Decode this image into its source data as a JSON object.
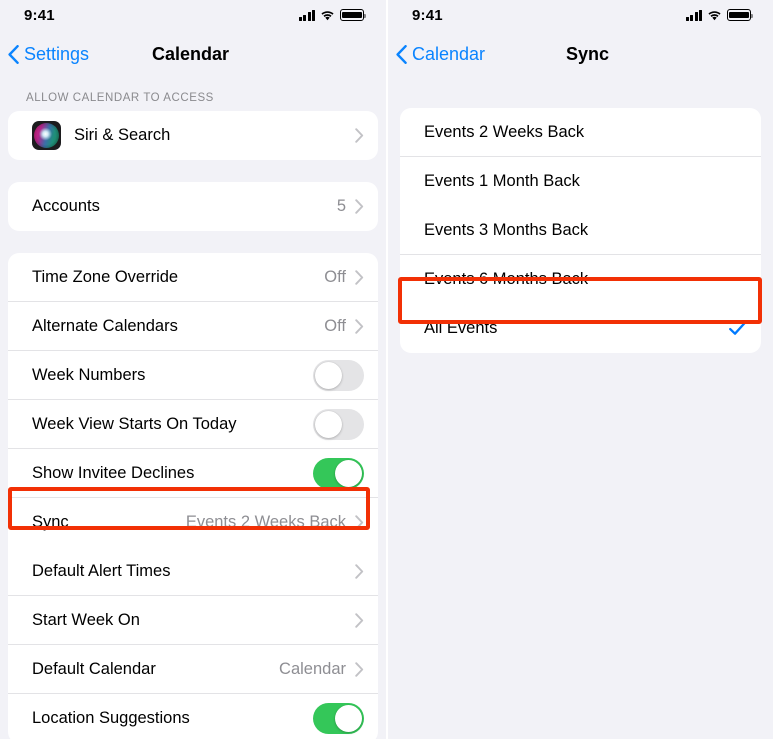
{
  "colors": {
    "accent_blue": "#0a84ff",
    "check_blue": "#007aff",
    "toggle_on_green": "#34c759",
    "highlight_red": "#f23005",
    "page_background": "#f2f2f7",
    "card_background": "#ffffff",
    "secondary_text": "#8e8e93"
  },
  "left_panel": {
    "status_bar": {
      "time": "9:41",
      "cellular_icon": "cellular-signal-icon",
      "wifi_icon": "wifi-icon",
      "battery_icon": "battery-full-icon"
    },
    "nav": {
      "back_label": "Settings",
      "back_icon": "chevron-left-icon",
      "title": "Calendar"
    },
    "sections": [
      {
        "header": "ALLOW CALENDAR TO ACCESS",
        "rows": [
          {
            "label": "Siri & Search",
            "value": "",
            "type": "disclosure",
            "icon": "siri-icon"
          }
        ]
      },
      {
        "header": "",
        "rows": [
          {
            "label": "Accounts",
            "value": "5",
            "type": "disclosure"
          }
        ]
      },
      {
        "header": "",
        "rows": [
          {
            "label": "Time Zone Override",
            "value": "Off",
            "type": "disclosure"
          },
          {
            "label": "Alternate Calendars",
            "value": "Off",
            "type": "disclosure"
          },
          {
            "label": "Week Numbers",
            "value": "",
            "type": "toggle",
            "on": false
          },
          {
            "label": "Week View Starts On Today",
            "value": "",
            "type": "toggle",
            "on": false
          },
          {
            "label": "Show Invitee Declines",
            "value": "",
            "type": "toggle",
            "on": true
          },
          {
            "label": "Sync",
            "value": "Events 2 Weeks Back",
            "type": "disclosure",
            "highlighted": true
          },
          {
            "label": "Default Alert Times",
            "value": "",
            "type": "disclosure"
          },
          {
            "label": "Start Week On",
            "value": "",
            "type": "disclosure"
          },
          {
            "label": "Default Calendar",
            "value": "Calendar",
            "type": "disclosure"
          },
          {
            "label": "Location Suggestions",
            "value": "",
            "type": "toggle",
            "on": true
          }
        ]
      }
    ]
  },
  "right_panel": {
    "status_bar": {
      "time": "9:41",
      "cellular_icon": "cellular-signal-icon",
      "wifi_icon": "wifi-icon",
      "battery_icon": "battery-full-icon"
    },
    "nav": {
      "back_label": "Calendar",
      "back_icon": "chevron-left-icon",
      "title": "Sync"
    },
    "options": [
      {
        "label": "Events 2 Weeks Back",
        "selected": false
      },
      {
        "label": "Events 1 Month Back",
        "selected": false
      },
      {
        "label": "Events 3 Months Back",
        "selected": false
      },
      {
        "label": "Events 6 Months Back",
        "selected": false
      },
      {
        "label": "All Events",
        "selected": true,
        "highlighted": true,
        "check_icon": "checkmark-icon"
      }
    ]
  }
}
